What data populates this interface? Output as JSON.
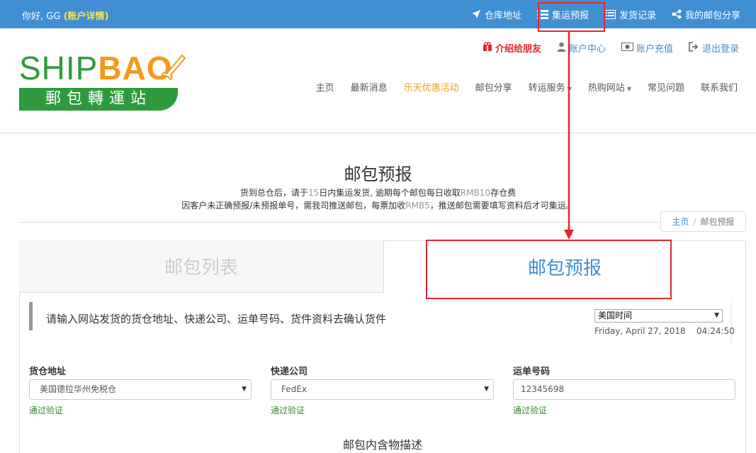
{
  "topbar": {
    "greeting": "你好, GG",
    "account_details": "(账户详情)",
    "links": [
      {
        "label": "仓库地址",
        "icon": "location-arrow-icon"
      },
      {
        "label": "集运预报",
        "icon": "list-icon"
      },
      {
        "label": "发货记录",
        "icon": "list-alt-icon"
      },
      {
        "label": "我的邮包分享",
        "icon": "share-icon"
      }
    ]
  },
  "logo": {
    "ship": "SHIP",
    "bao": "BAO",
    "subtitle": "郵包轉運站"
  },
  "sublinks": [
    {
      "label": "介绍给朋友",
      "icon": "gift-icon"
    },
    {
      "label": "账户中心",
      "icon": "user-icon"
    },
    {
      "label": "账户充值",
      "icon": "money-icon"
    },
    {
      "label": "退出登录",
      "icon": "logout-icon"
    }
  ],
  "nav": [
    {
      "label": "主页"
    },
    {
      "label": "最新消息"
    },
    {
      "label": "乐天优惠活动"
    },
    {
      "label": "邮包分享"
    },
    {
      "label": "转运服务"
    },
    {
      "label": "热购网站"
    },
    {
      "label": "常见问题"
    },
    {
      "label": "联系我们"
    }
  ],
  "page": {
    "title": "邮包预报",
    "notice1_a": "货到总仓后，请于",
    "notice1_b": "15",
    "notice1_c": "日内集运发货, 逾期每个邮包每日收取",
    "notice1_d": "RMB10",
    "notice1_e": "存仓费",
    "notice2_a": "因客户未正确预报/未预报单号，需我司推送邮包，每票加收",
    "notice2_b": "RMB5",
    "notice2_c": "，推送邮包需要填写资料后才可集运。"
  },
  "breadcrumb": {
    "home": "主页",
    "sep": "/",
    "current": "邮包预报"
  },
  "tabs": {
    "list": "邮包列表",
    "forecast": "邮包预报"
  },
  "form": {
    "instruction": "请输入网站发货的货仓地址、快递公司、运单号码、货件资料去确认货件",
    "timezone": "美国时间",
    "date": "Friday, April 27, 2018",
    "time": "04:24:50",
    "warehouse_label": "货仓地址",
    "warehouse_value": "美国德拉华州免税仓",
    "courier_label": "快递公司",
    "courier_value": "FedEx",
    "tracking_label": "运单号码",
    "tracking_value": "12345698",
    "valid_text": "通过验证",
    "contents_title": "邮包内含物描述"
  }
}
